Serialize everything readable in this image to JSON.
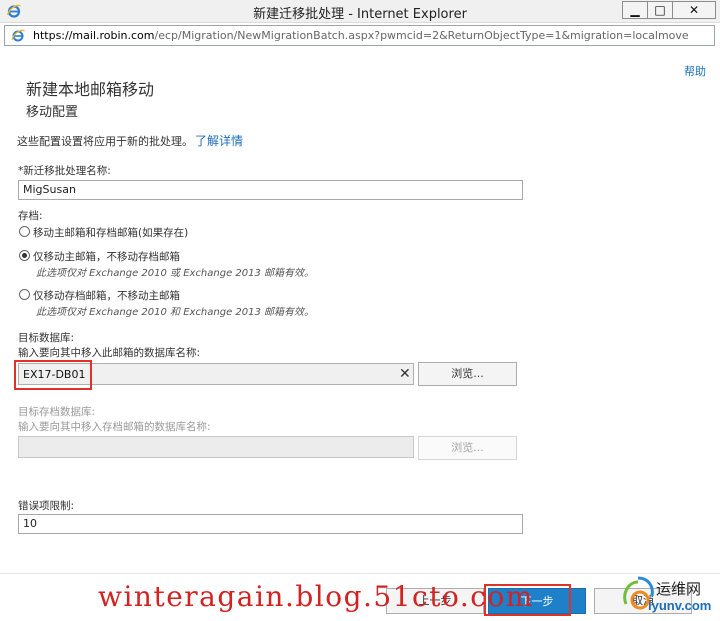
{
  "window": {
    "title": "新建迁移批处理 - Internet Explorer",
    "minimize_glyph": "▁",
    "maximize_glyph": "□",
    "close_glyph": "✕"
  },
  "addressbar": {
    "url_host": "https://mail.robin.com",
    "url_path": "/ecp/Migration/NewMigrationBatch.aspx?pwmcid=2&ReturnObjectType=1&migration=localmove"
  },
  "page": {
    "help": "帮助",
    "title": "新建本地邮箱移动",
    "subtitle": "移动配置",
    "intro": "这些配置设置将应用于新的批处理。",
    "learn_more": "了解详情"
  },
  "form": {
    "batch_name_label": "*新迁移批处理名称:",
    "batch_name_value": "MigSusan",
    "archive_label": "存档:",
    "radio_options": [
      {
        "label": "移动主邮箱和存档邮箱(如果存在)",
        "checked": false,
        "note": ""
      },
      {
        "label": "仅移动主邮箱，不移动存档邮箱",
        "checked": true,
        "note": "此选项仅对 Exchange 2010 或 Exchange 2013 邮箱有效。"
      },
      {
        "label": "仅移动存档邮箱，不移动主邮箱",
        "checked": false,
        "note": "此选项仅对 Exchange 2010 和 Exchange 2013 邮箱有效。"
      }
    ],
    "target_db_label": "目标数据库:",
    "target_db_hint": "输入要向其中移入此邮箱的数据库名称:",
    "target_db_value": "EX17-DB01",
    "clear_glyph": "✕",
    "browse_label": "浏览...",
    "target_archive_db_label": "目标存档数据库:",
    "target_archive_db_hint": "输入要向其中移入存档邮箱的数据库名称:",
    "browse_archive_label": "浏览...",
    "error_limit_label": "错误项限制:",
    "error_limit_value": "10"
  },
  "footer": {
    "back_label": "上一步",
    "next_label": "下一步",
    "cancel_label": "取消"
  },
  "overlay": {
    "watermark": "winteragain.blog.51cto.com",
    "brand_name": "运维网",
    "brand_url": "iyunv.com"
  },
  "colors": {
    "link": "#1e6fb8",
    "primary_button": "#1e80c8",
    "highlight": "#e0322b"
  }
}
